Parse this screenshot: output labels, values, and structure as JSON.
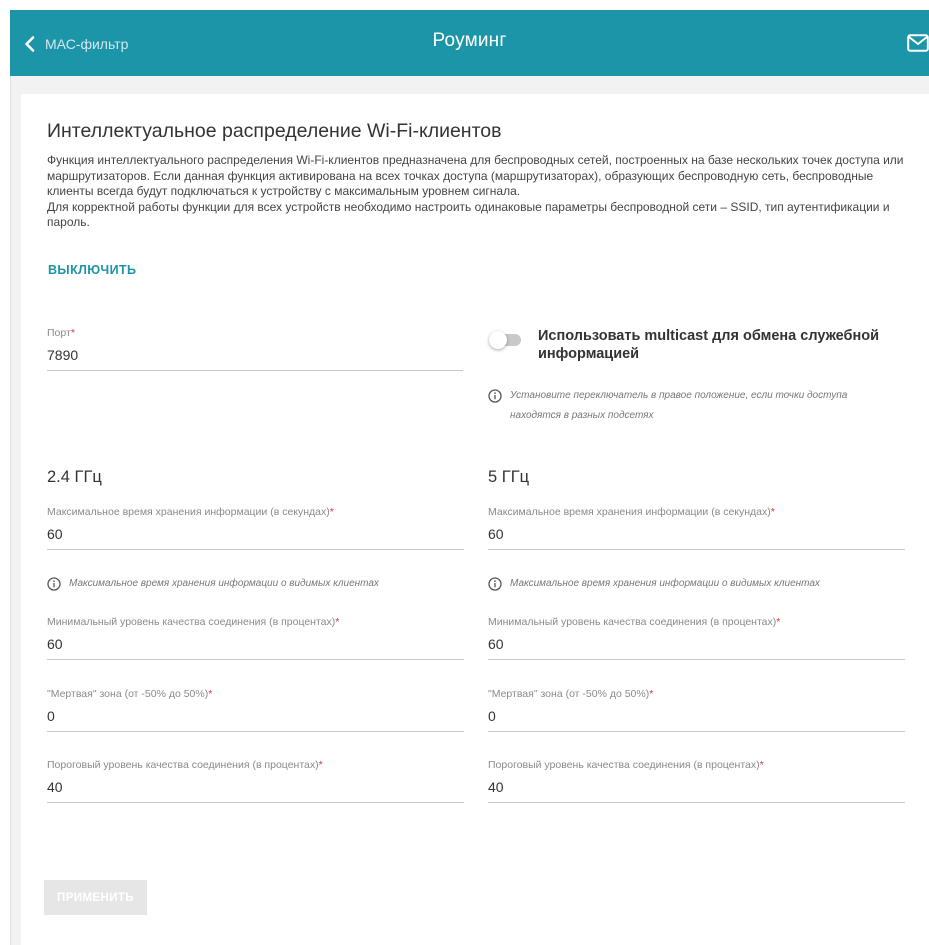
{
  "header": {
    "back_label": "МАС-фильтр",
    "title": "Роуминг",
    "mail_icon": "mail-icon"
  },
  "section": {
    "title": "Интеллектуальное распределение Wi-Fi-клиентов",
    "description_1": "Функция интеллектуального распределения Wi-Fi-клиентов предназначена для беспроводных сетей, построенных на базе нескольких точек доступа или маршрутизаторов. Если данная функция активирована на всех точках доступа (маршрутизаторах), образующих беспроводную сеть, беспроводные клиенты всегда будут подключаться к устройству с максимальным уровнем сигнала.",
    "description_2": "Для корректной работы функции для всех устройств необходимо настроить одинаковые параметры беспроводной сети – SSID, тип аутентификации и пароль.",
    "toggle_link": "ВЫКЛЮЧИТЬ"
  },
  "port": {
    "label": "Порт",
    "value": "7890"
  },
  "multicast": {
    "label": "Использовать multicast для обмена служебной информацией",
    "enabled": false,
    "hint": "Установите переключатель в правое положение, если точки доступа находятся в разных подсетях"
  },
  "band_24": {
    "title": "2.4 ГГц",
    "storage_label": "Максимальное время хранения информации (в секундах)",
    "storage_value": "60",
    "storage_hint": "Максимальное время хранения информации о видимых клиентах",
    "min_quality_label": "Минимальный уровень качества соединения (в процентах)",
    "min_quality_value": "60",
    "dead_zone_label": "\"Мертвая\" зона (от -50% до 50%)",
    "dead_zone_value": "0",
    "threshold_label": "Пороговый уровень качества соединения (в процентах)",
    "threshold_value": "40"
  },
  "band_5": {
    "title": "5 ГГц",
    "storage_label": "Максимальное время хранения информации (в секундах)",
    "storage_value": "60",
    "storage_hint": "Максимальное время хранения информации о видимых клиентах",
    "min_quality_label": "Минимальный уровень качества соединения (в процентах)",
    "min_quality_value": "60",
    "dead_zone_label": "\"Мертвая\" зона (от -50% до 50%)",
    "dead_zone_value": "0",
    "threshold_label": "Пороговый уровень качества соединения (в процентах)",
    "threshold_value": "40"
  },
  "required_mark": "*",
  "apply_label": "ПРИМЕНИТЬ",
  "colors": {
    "accent": "#1c95a9",
    "required": "#e1312f",
    "disabled_button": "#e6e6e6"
  }
}
